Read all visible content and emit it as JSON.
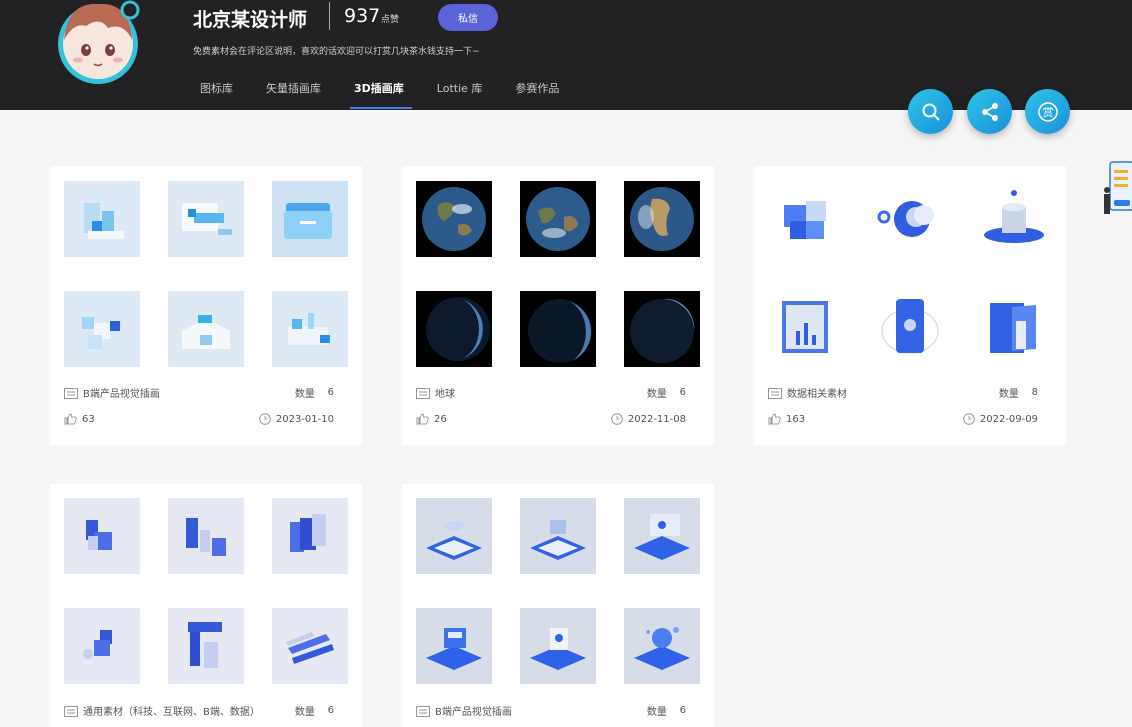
{
  "profile": {
    "name": "北京某设计师",
    "likes_count": "937",
    "likes_label": "点赞",
    "message_label": "私信",
    "bio": "免费素材会在评论区说明，喜欢的话欢迎可以打赏几块茶水钱支持一下~"
  },
  "tabs": [
    {
      "label": "图标库",
      "active": false
    },
    {
      "label": "矢量插画库",
      "active": false
    },
    {
      "label": "3D插画库",
      "active": true
    },
    {
      "label": "Lottie 库",
      "active": false
    },
    {
      "label": "参赛作品",
      "active": false
    }
  ],
  "fabs": {
    "search": "search-icon",
    "share": "share-icon",
    "reward_glyph": "赏"
  },
  "colors": {
    "header_bg": "#222225",
    "accent": "#5b63d9",
    "fab": "#22b0e4",
    "tab_underline": "#4b7be8"
  },
  "count_label": "数量",
  "cards": [
    {
      "title": "B端产品视觉插画",
      "count": "6",
      "likes": "63",
      "date": "2023-01-10",
      "theme": "light-blue"
    },
    {
      "title": "地球",
      "count": "6",
      "likes": "26",
      "date": "2022-11-08",
      "theme": "earth"
    },
    {
      "title": "数据相关素材",
      "count": "8",
      "likes": "163",
      "date": "2022-09-09",
      "theme": "blue-3d"
    },
    {
      "title": "通用素材（科技、互联网、B端、数据）",
      "count": "6",
      "likes": "",
      "date": "",
      "theme": "lavender"
    },
    {
      "title": "B端产品视觉插画",
      "count": "6",
      "likes": "",
      "date": "",
      "theme": "platform"
    }
  ]
}
